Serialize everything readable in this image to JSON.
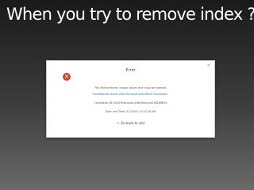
{
  "slide": {
    "title": "When you try to remove index ?"
  },
  "dialog": {
    "close_icon": "close-icon",
    "error_icon": "error-icon",
    "heading": "Error",
    "message": "This field enforces unique values and must be indexed.",
    "link_text": "Troubleshoot issues with Microsoft SharePoint Foundation.",
    "correlation": "Correlation ID: b2d2f5da-bcad-4fb6-9dcb-aa29826f8f1e",
    "datetime": "Date and Time: 2/7/2013 11:53:26 AM",
    "go_back": "Go back to site"
  },
  "colors": {
    "error": "#d24726",
    "link": "#2a6fbb",
    "star": "#f5a623"
  }
}
